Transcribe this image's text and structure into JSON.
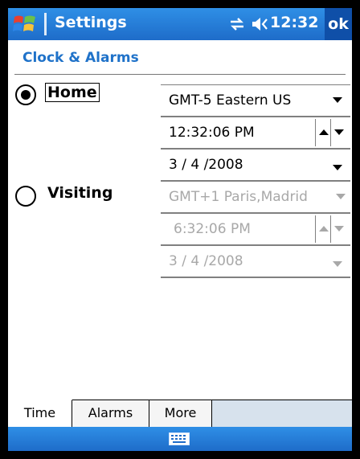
{
  "titlebar": {
    "title": "Settings",
    "time": "12:32",
    "ok_label": "ok",
    "icons": [
      "windows-start-icon",
      "connectivity-icon",
      "volume-icon"
    ]
  },
  "page": {
    "title": "Clock & Alarms"
  },
  "home": {
    "label": "Home",
    "selected": true,
    "timezone": "GMT-5 Eastern US",
    "time": "12:32:06 PM",
    "date": "3 / 4 /2008"
  },
  "visiting": {
    "label": "Visiting",
    "selected": false,
    "timezone": "GMT+1 Paris,Madrid",
    "time": "6:32:06 PM",
    "date": "3 / 4 /2008"
  },
  "tabs": [
    {
      "label": "Time",
      "active": true
    },
    {
      "label": "Alarms",
      "active": false
    },
    {
      "label": "More",
      "active": false
    }
  ],
  "menubar": {
    "icon": "keyboard-icon"
  },
  "colors": {
    "accent": "#1f72c9",
    "titlebar": "#2f8fe6",
    "disabled_text": "#a8a8a8"
  }
}
